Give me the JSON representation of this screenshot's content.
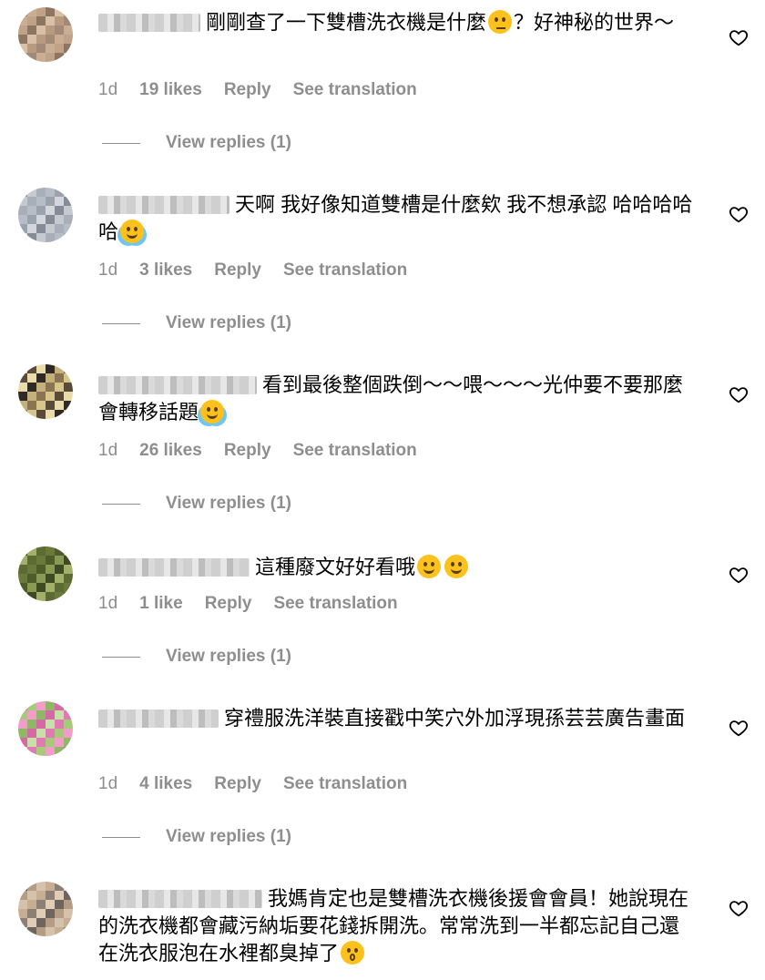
{
  "comments": [
    {
      "text_before": "剛剛查了一下雙槽洗衣機是什麼",
      "emoji1": "thinking-face",
      "text_after": "？好神秘的世界～",
      "age": "1d",
      "likes": "19 likes",
      "reply": "Reply",
      "translate": "See translation",
      "view_replies": "View replies (1)"
    },
    {
      "text_before": "天啊 我好像知道雙槽是什麼欸 我不想承認 哈哈哈哈哈",
      "emoji1": "tears-of-joy",
      "text_after": "",
      "age": "1d",
      "likes": "3 likes",
      "reply": "Reply",
      "translate": "See translation",
      "view_replies": "View replies (1)"
    },
    {
      "text_before": "看到最後整個跌倒～～喂～～～光仲要不要那麼會轉移話題",
      "emoji1": "tears-of-joy",
      "text_after": "",
      "age": "1d",
      "likes": "26 likes",
      "reply": "Reply",
      "translate": "See translation",
      "view_replies": "View replies (1)"
    },
    {
      "text_before": "這種廢文好好看哦",
      "emoji1": "rofl",
      "emoji2": "rofl",
      "text_after": "",
      "age": "1d",
      "likes": "1 like",
      "reply": "Reply",
      "translate": "See translation",
      "view_replies": "View replies (1)"
    },
    {
      "text_before": "穿禮服洗洋裝直接戳中笑穴外加浮現孫芸芸廣告畫面",
      "text_after": "",
      "age": "1d",
      "likes": "4 likes",
      "reply": "Reply",
      "translate": "See translation",
      "view_replies": "View replies (1)"
    },
    {
      "text_before": "我媽肯定也是雙槽洗衣機後援會會員！她說現在的洗衣機都會藏污納垢要花錢拆開洗。常常洗到一半都忘記自己還在洗衣服泡在水裡都臭掉了",
      "emoji1": "face-with-rolling-eyes",
      "text_after": ""
    }
  ],
  "colors": {
    "meta": "#8e8e8e",
    "text": "#000000"
  }
}
